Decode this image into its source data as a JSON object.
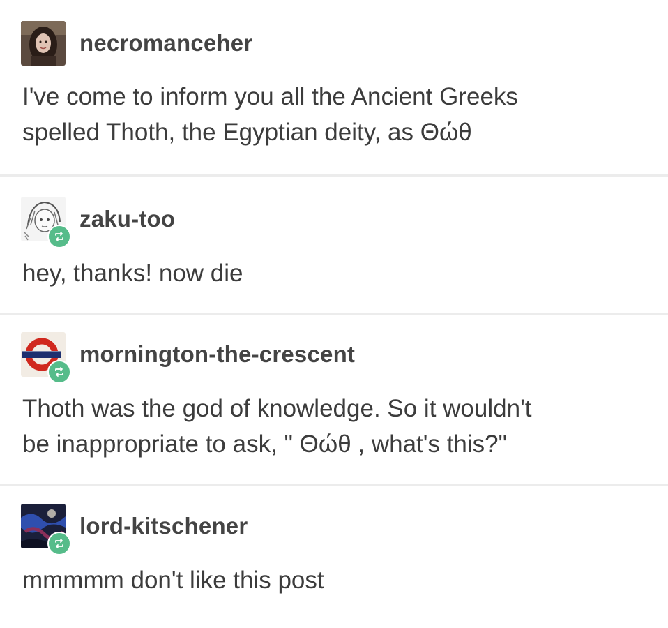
{
  "posts": [
    {
      "username": "necromanceher",
      "avatar": "profile-photo-avatar",
      "reblogged": false,
      "lines": [
        "I've come to inform you all the Ancient Greeks",
        "spelled Thoth, the Egyptian deity, as Θώθ"
      ]
    },
    {
      "username": "zaku-too",
      "avatar": "anime-sketch-avatar",
      "reblogged": true,
      "lines": [
        "hey, thanks! now die"
      ]
    },
    {
      "username": "mornington-the-crescent",
      "avatar": "underground-roundel-avatar",
      "reblogged": true,
      "lines": [
        "Thoth was the god of knowledge. So it wouldn't",
        "be inappropriate to ask, \" Θώθ , what's this?\""
      ]
    },
    {
      "username": "lord-kitschener",
      "avatar": "abstract-art-avatar",
      "reblogged": true,
      "lines": [
        "mmmmm don't like this post"
      ]
    }
  ],
  "colors": {
    "reblog_badge": "#56bc8a",
    "divider": "#ececec",
    "text": "#3c3c3c"
  }
}
